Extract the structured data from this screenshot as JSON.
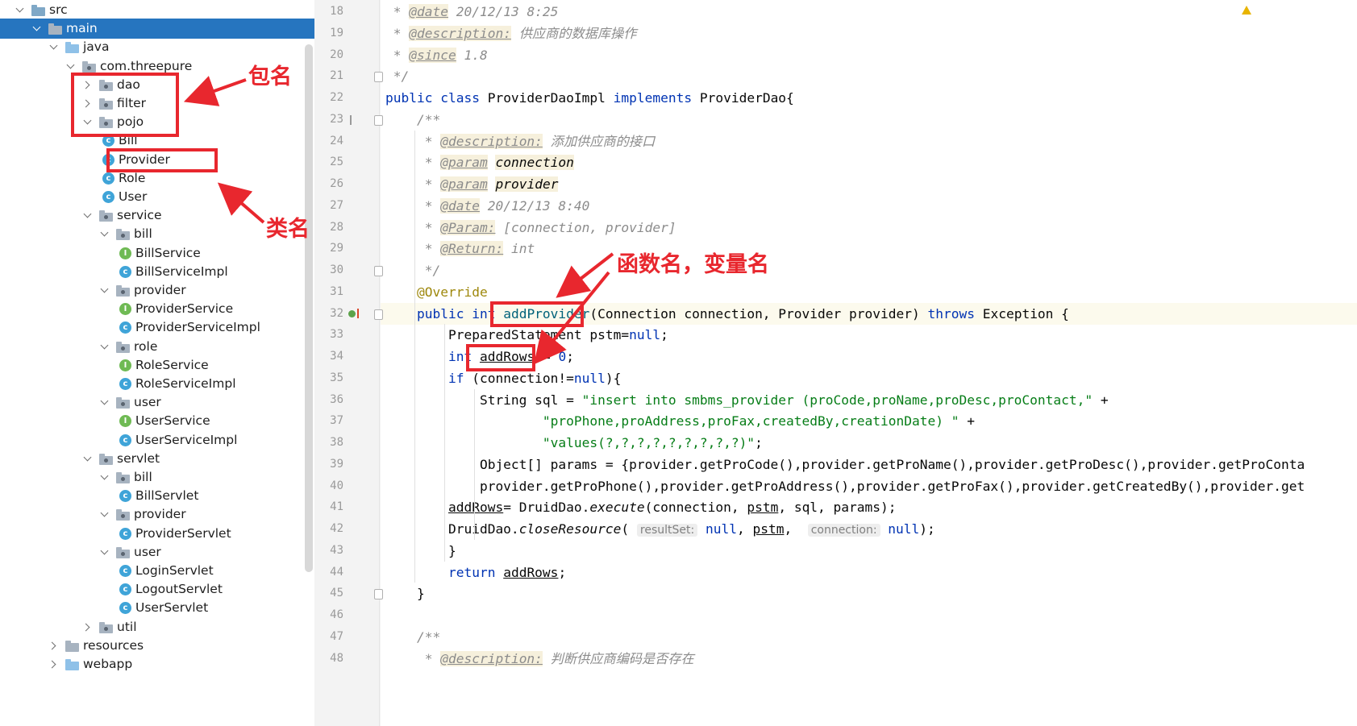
{
  "project_tree": {
    "rows": [
      {
        "label": "src",
        "indent": 0,
        "arrow": "down",
        "icon": "folder-src"
      },
      {
        "label": "main",
        "indent": 1,
        "arrow": "down",
        "icon": "folder",
        "selected": true
      },
      {
        "label": "java",
        "indent": 2,
        "arrow": "down",
        "icon": "folder-blue"
      },
      {
        "label": "com.threepure",
        "indent": 3,
        "arrow": "down",
        "icon": "package"
      },
      {
        "label": "dao",
        "indent": 4,
        "arrow": "right",
        "icon": "package"
      },
      {
        "label": "filter",
        "indent": 4,
        "arrow": "right",
        "icon": "package"
      },
      {
        "label": "pojo",
        "indent": 4,
        "arrow": "down",
        "icon": "package"
      },
      {
        "label": "Bill",
        "indent": 5,
        "arrow": "none",
        "icon": "class"
      },
      {
        "label": "Provider",
        "indent": 5,
        "arrow": "none",
        "icon": "class"
      },
      {
        "label": "Role",
        "indent": 5,
        "arrow": "none",
        "icon": "class"
      },
      {
        "label": "User",
        "indent": 5,
        "arrow": "none",
        "icon": "class"
      },
      {
        "label": "service",
        "indent": 4,
        "arrow": "down",
        "icon": "package"
      },
      {
        "label": "bill",
        "indent": 5,
        "arrow": "down",
        "icon": "package"
      },
      {
        "label": "BillService",
        "indent": 6,
        "arrow": "none",
        "icon": "interface"
      },
      {
        "label": "BillServiceImpl",
        "indent": 6,
        "arrow": "none",
        "icon": "class"
      },
      {
        "label": "provider",
        "indent": 5,
        "arrow": "down",
        "icon": "package"
      },
      {
        "label": "ProviderService",
        "indent": 6,
        "arrow": "none",
        "icon": "interface"
      },
      {
        "label": "ProviderServiceImpl",
        "indent": 6,
        "arrow": "none",
        "icon": "class"
      },
      {
        "label": "role",
        "indent": 5,
        "arrow": "down",
        "icon": "package"
      },
      {
        "label": "RoleService",
        "indent": 6,
        "arrow": "none",
        "icon": "interface"
      },
      {
        "label": "RoleServiceImpl",
        "indent": 6,
        "arrow": "none",
        "icon": "class"
      },
      {
        "label": "user",
        "indent": 5,
        "arrow": "down",
        "icon": "package"
      },
      {
        "label": "UserService",
        "indent": 6,
        "arrow": "none",
        "icon": "interface"
      },
      {
        "label": "UserServiceImpl",
        "indent": 6,
        "arrow": "none",
        "icon": "class"
      },
      {
        "label": "servlet",
        "indent": 4,
        "arrow": "down",
        "icon": "package"
      },
      {
        "label": "bill",
        "indent": 5,
        "arrow": "down",
        "icon": "package"
      },
      {
        "label": "BillServlet",
        "indent": 6,
        "arrow": "none",
        "icon": "class"
      },
      {
        "label": "provider",
        "indent": 5,
        "arrow": "down",
        "icon": "package"
      },
      {
        "label": "ProviderServlet",
        "indent": 6,
        "arrow": "none",
        "icon": "class"
      },
      {
        "label": "user",
        "indent": 5,
        "arrow": "down",
        "icon": "package"
      },
      {
        "label": "LoginServlet",
        "indent": 6,
        "arrow": "none",
        "icon": "class"
      },
      {
        "label": "LogoutServlet",
        "indent": 6,
        "arrow": "none",
        "icon": "class"
      },
      {
        "label": "UserServlet",
        "indent": 6,
        "arrow": "none",
        "icon": "class"
      },
      {
        "label": "util",
        "indent": 4,
        "arrow": "right",
        "icon": "package"
      },
      {
        "label": "resources",
        "indent": 2,
        "arrow": "right",
        "icon": "folder-res"
      },
      {
        "label": "webapp",
        "indent": 2,
        "arrow": "right",
        "icon": "folder-blue"
      }
    ]
  },
  "editor": {
    "current_line": 32,
    "lines": [
      {
        "n": "18",
        "html": " <span class=\"cm\">* </span><span class=\"tag\">@date</span><span class=\"cm\"> 20/12/13 8:25</span>"
      },
      {
        "n": "19",
        "html": " <span class=\"cm\">* </span><span class=\"tag\">@description:</span><span class=\"cm\"> 供应商的数据库操作</span>"
      },
      {
        "n": "20",
        "html": " <span class=\"cm\">* </span><span class=\"tag\">@since</span><span class=\"cm\"> 1.8</span>"
      },
      {
        "n": "21",
        "html": " <span class=\"cm\">*/</span>"
      },
      {
        "n": "22",
        "html": "<span class=\"kw\">public class</span> ProviderDaoImpl <span class=\"kw\">implements</span> ProviderDao{"
      },
      {
        "n": "23",
        "html": "    <span class=\"cm\">/**</span>"
      },
      {
        "n": "24",
        "html": "     <span class=\"cm\">* </span><span class=\"tag\">@description:</span><span class=\"cm\"> 添加供应商的接口</span>"
      },
      {
        "n": "25",
        "html": "     <span class=\"cm\">* </span><span class=\"tag\">@param</span> <span class=\"pname\">connection</span>"
      },
      {
        "n": "26",
        "html": "     <span class=\"cm\">* </span><span class=\"tag\">@param</span> <span class=\"pname\">provider</span>"
      },
      {
        "n": "27",
        "html": "     <span class=\"cm\">* </span><span class=\"tag\">@date</span><span class=\"cm\"> 20/12/13 8:40</span>"
      },
      {
        "n": "28",
        "html": "     <span class=\"cm\">* </span><span class=\"tag\">@Param:</span><span class=\"cm\"> [connection, provider]</span>"
      },
      {
        "n": "29",
        "html": "     <span class=\"cm\">* </span><span class=\"tag\">@Return:</span><span class=\"cm\"> int</span>"
      },
      {
        "n": "30",
        "html": "     <span class=\"cm\">*/</span>"
      },
      {
        "n": "31",
        "html": "    <span class=\"ann\">@Override</span>"
      },
      {
        "n": "32",
        "html": "    <span class=\"kw\">public int</span> <span class=\"fn\">addProvider</span>(Connection connection, Provider provider) <span class=\"kw\">throws</span> Exception {"
      },
      {
        "n": "33",
        "html": "        PreparedStatement pstm=<span class=\"kw\">null</span>;"
      },
      {
        "n": "34",
        "html": "        <span class=\"kw\">int</span> <span style=\"text-decoration:underline\">addRows</span> = <span class=\"kw\">0</span>;"
      },
      {
        "n": "35",
        "html": "        <span class=\"kw\">if</span> (connection!=<span class=\"kw\">null</span>){"
      },
      {
        "n": "36",
        "html": "            String sql = <span class=\"str\">\"insert into smbms_provider (proCode,proName,proDesc,proContact,\"</span> +"
      },
      {
        "n": "37",
        "html": "                    <span class=\"str\">\"proPhone,proAddress,proFax,createdBy,creationDate) \"</span> +"
      },
      {
        "n": "38",
        "html": "                    <span class=\"str\">\"values(?,?,?,?,?,?,?,?,?)\"</span>;"
      },
      {
        "n": "39",
        "html": "            Object[] params = {provider.getProCode(),provider.getProName(),provider.getProDesc(),provider.getProConta"
      },
      {
        "n": "40",
        "html": "            provider.getProPhone(),provider.getProAddress(),provider.getProFax(),provider.getCreatedBy(),provider.get"
      },
      {
        "n": "41",
        "html": "        <span style=\"text-decoration:underline\">addRows</span>= DruidDao.<span class=\"ital\">execute</span>(connection, <span style=\"text-decoration:underline\">pstm</span>, sql, params);"
      },
      {
        "n": "42",
        "html": "        DruidDao.<span class=\"ital\">closeResource</span>( <span class=\"hint\">resultSet:</span> <span class=\"kw\">null</span>, <span style=\"text-decoration:underline\">pstm</span>,  <span class=\"hint\">connection:</span> <span class=\"kw\">null</span>);"
      },
      {
        "n": "43",
        "html": "        }"
      },
      {
        "n": "44",
        "html": "        <span class=\"kw\">return</span> <span style=\"text-decoration:underline\">addRows</span>;"
      },
      {
        "n": "45",
        "html": "    }"
      },
      {
        "n": "46",
        "html": ""
      },
      {
        "n": "47",
        "html": "    <span class=\"cm\">/**</span>"
      },
      {
        "n": "48",
        "html": "     <span class=\"cm\">* </span><span class=\"tag\">@description:</span><span class=\"cm\"> 判断供应商编码是否存在</span>"
      }
    ]
  },
  "annotations": {
    "package_label": "包名",
    "class_label": "类名",
    "function_var_label": "函数名，变量名"
  },
  "colors": {
    "annotation_red": "#e8272e",
    "selection_blue": "#2675bf",
    "keyword": "#0033b3",
    "string": "#067d17",
    "annotation_yellow": "#9e880d"
  },
  "icons": [
    "chevron-down-icon",
    "chevron-right-icon",
    "folder-icon",
    "package-icon",
    "class-icon",
    "interface-icon",
    "warning-icon",
    "override-gutter-icon",
    "fold-marker-icon",
    "doc-comment-icon"
  ]
}
